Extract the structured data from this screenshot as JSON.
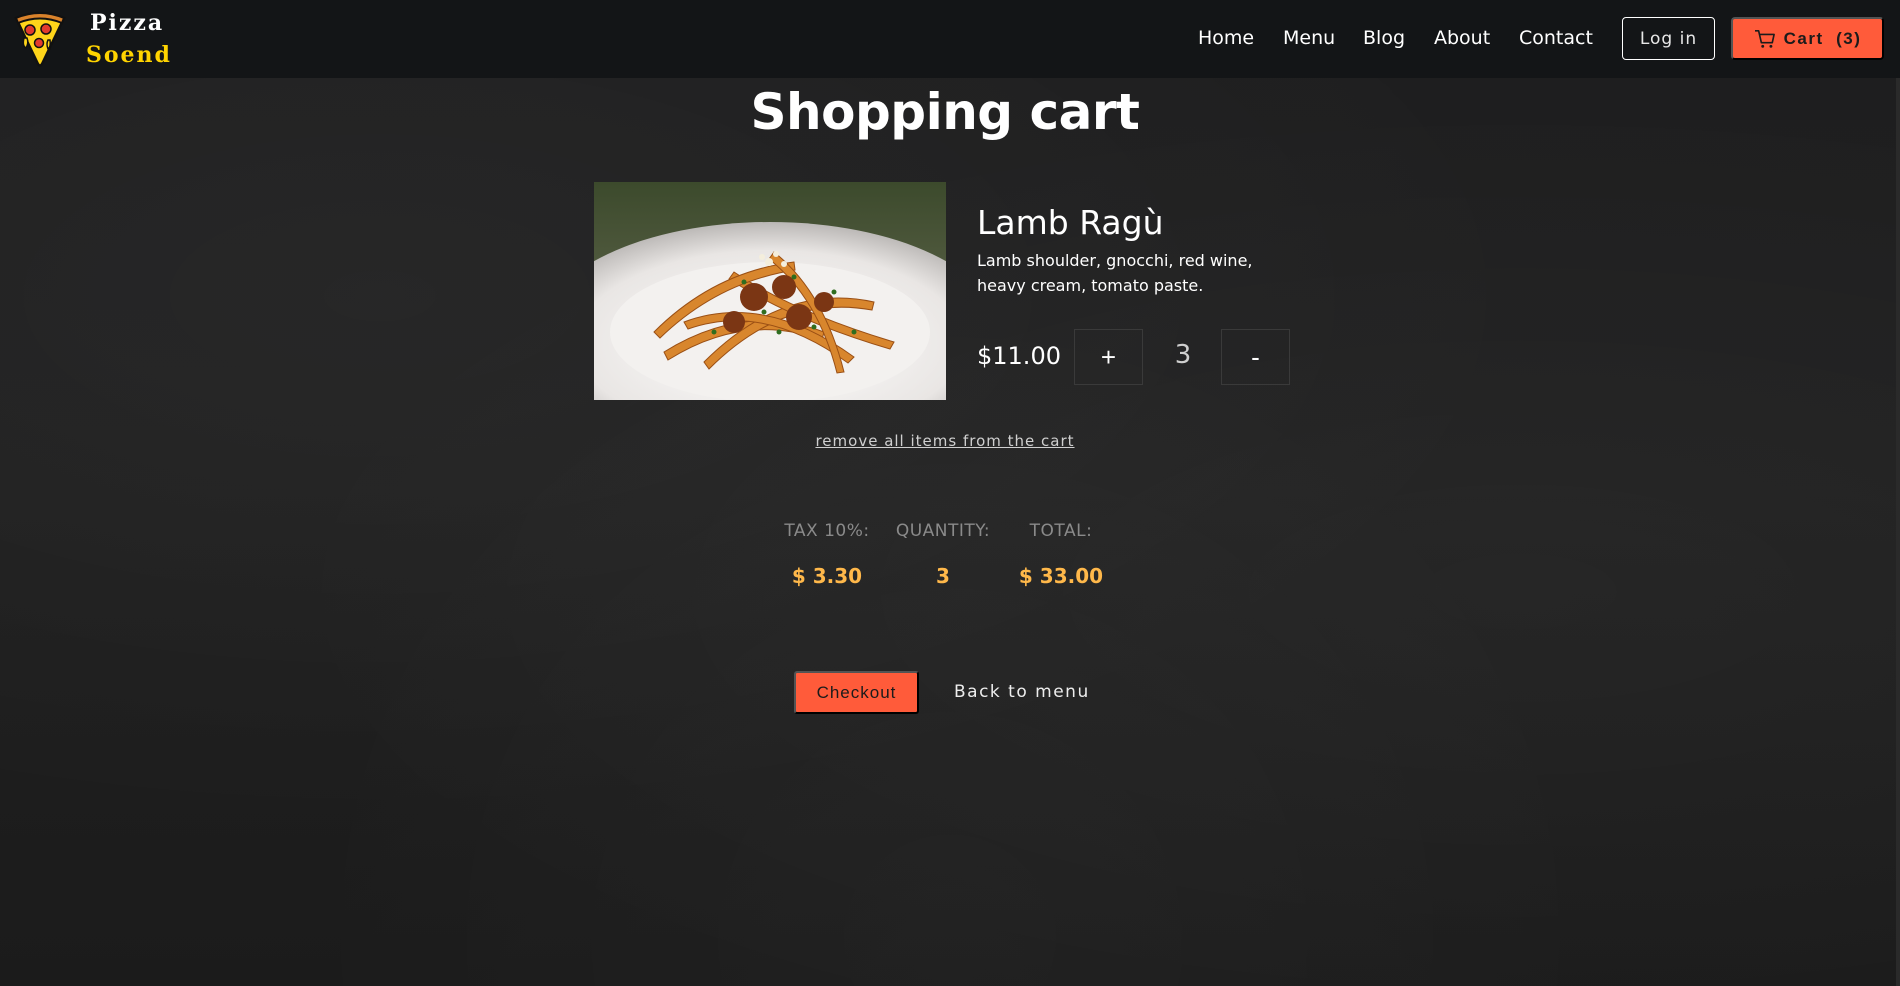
{
  "header": {
    "brand_line1": "Pizza",
    "brand_line2": "Soend",
    "nav": [
      "Home",
      "Menu",
      "Blog",
      "About",
      "Contact"
    ],
    "login_label": "Log in",
    "cart_label": "Cart  (3)"
  },
  "page": {
    "title": "Shopping cart"
  },
  "cart_item": {
    "name": "Lamb Ragù",
    "description": "Lamb shoulder, gnocchi, red wine, heavy cream, tomato paste.",
    "price": "$11.00",
    "increment_label": "+",
    "quantity": "3",
    "decrement_label": "-"
  },
  "remove_all_label": "remove all items from the cart",
  "summary": {
    "tax_label": "TAX 10%:",
    "tax_value": "$ 3.30",
    "quantity_label": "QUANTITY:",
    "quantity_value": "3",
    "total_label": "TOTAL:",
    "total_value": "$ 33.00"
  },
  "actions": {
    "checkout_label": "Checkout",
    "back_label": "Back to menu"
  },
  "icons": {
    "logo": "pizza-slice-icon",
    "cart": "shopping-cart-icon"
  },
  "colors": {
    "accent": "#ff5b3a",
    "brand_yellow": "#ffd400",
    "summary_value": "#ffb84a",
    "header_bg": "#131517"
  }
}
